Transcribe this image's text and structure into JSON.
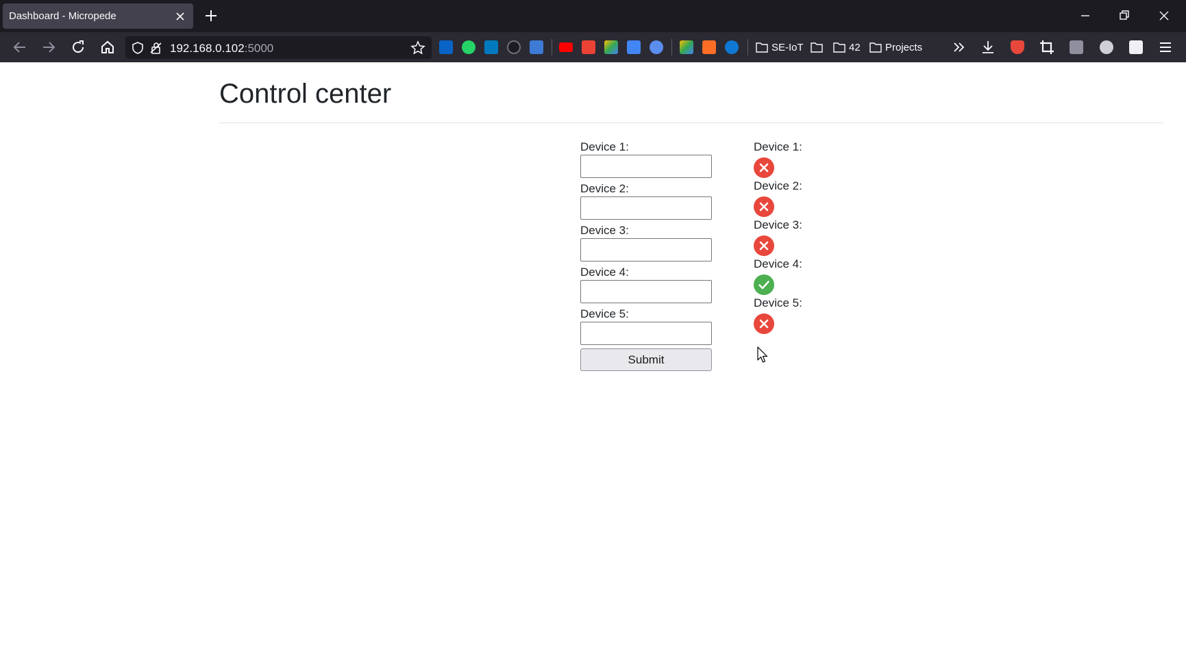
{
  "browser": {
    "tab_title": "Dashboard - Micropede",
    "url_host": "192.168.0.102",
    "url_port": ":5000",
    "bookmarks": [
      {
        "label": "SE-IoT"
      },
      {
        "label": ""
      },
      {
        "label": "42"
      },
      {
        "label": "Projects"
      }
    ],
    "extension_icons": [
      "outlook-icon",
      "whatsapp-icon",
      "trello-icon",
      "github-icon",
      "app-icon",
      "youtube-icon",
      "gmail-icon",
      "drive-icon",
      "translate-icon",
      "graduation-icon",
      "google-drive-icon",
      "gitlab-icon",
      "onedrive-icon"
    ],
    "colors": {
      "tabbar": "#1c1b22",
      "toolbar": "#2b2a33",
      "active_tab": "#42414d"
    }
  },
  "page": {
    "title": "Control center",
    "form": {
      "fields": [
        {
          "label": "Device 1:",
          "value": ""
        },
        {
          "label": "Device 2:",
          "value": ""
        },
        {
          "label": "Device 3:",
          "value": ""
        },
        {
          "label": "Device 4:",
          "value": ""
        },
        {
          "label": "Device 5:",
          "value": ""
        }
      ],
      "submit_label": "Submit"
    },
    "statuses": [
      {
        "label": "Device 1:",
        "state": "off",
        "icon": "error-x-icon"
      },
      {
        "label": "Device 2:",
        "state": "off",
        "icon": "error-x-icon"
      },
      {
        "label": "Device 3:",
        "state": "off",
        "icon": "error-x-icon"
      },
      {
        "label": "Device 4:",
        "state": "on",
        "icon": "success-check-icon"
      },
      {
        "label": "Device 5:",
        "state": "off",
        "icon": "error-x-icon"
      }
    ],
    "colors": {
      "off": "#e8473c",
      "on": "#4caf50"
    }
  }
}
